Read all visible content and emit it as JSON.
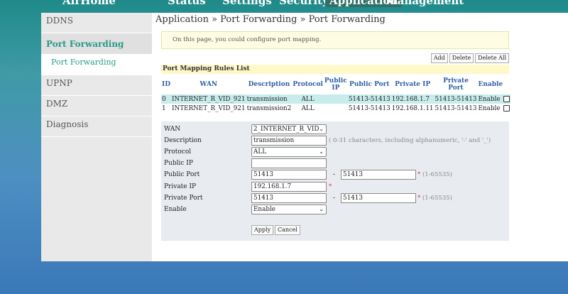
{
  "nav": {
    "brand": "AirHome",
    "tabs": [
      "Status",
      "Settings",
      "Security",
      "Application",
      "Management"
    ],
    "active_tab": "Application"
  },
  "sidebar": {
    "items": [
      "DDNS",
      "Port Forwarding",
      "Port Forwarding",
      "UPNP",
      "DMZ",
      "Diagnosis"
    ]
  },
  "breadcrumb": "Application » Port Forwarding » Port Forwarding",
  "info": "On this page, you could configure port mapping.",
  "buttons": {
    "add": "Add",
    "delete": "Delete",
    "delete_all": "Delete All"
  },
  "list_title": "Port Mapping Rules List",
  "table": {
    "headers": [
      "ID",
      "WAN",
      "Description",
      "Protocol",
      "Public IP",
      "Public Port",
      "Private IP",
      "Private Port",
      "Enable"
    ],
    "rows": [
      [
        "0",
        "INTERNET_R_VID_921",
        "transmission",
        "ALL",
        "",
        "51413-51413",
        "192.168.1.7",
        "51413-51413",
        "Enable"
      ],
      [
        "1",
        "INTERNET_R_VID_921",
        "transmission2",
        "ALL",
        "",
        "51413-51413",
        "192.168.1.11",
        "51413-51413",
        "Enable"
      ]
    ]
  },
  "form": {
    "labels": [
      "WAN",
      "Description",
      "Protocol",
      "Public IP",
      "Public Port",
      "Private IP",
      "Private Port",
      "Enable"
    ],
    "wan": "2_INTERNET_R_VID",
    "description": "transmission",
    "description_hint": "( 0-31 characters, including alphanumeric, '-' and '_')",
    "protocol": "ALL",
    "public_ip": "",
    "public_port_start": "51413",
    "public_port_end": "51413",
    "port_range_hint": "(1-65535)",
    "private_ip": "192.168.1.7",
    "private_port_start": "51413",
    "private_port_end": "51413",
    "enable": "Enable",
    "apply": "Apply",
    "cancel": "Cancel",
    "dash": "-",
    "required": "*"
  },
  "colors": {
    "accent": "#2a9b8a",
    "header_blue": "#2e5fa7",
    "selected_row": "#c8ecec"
  }
}
